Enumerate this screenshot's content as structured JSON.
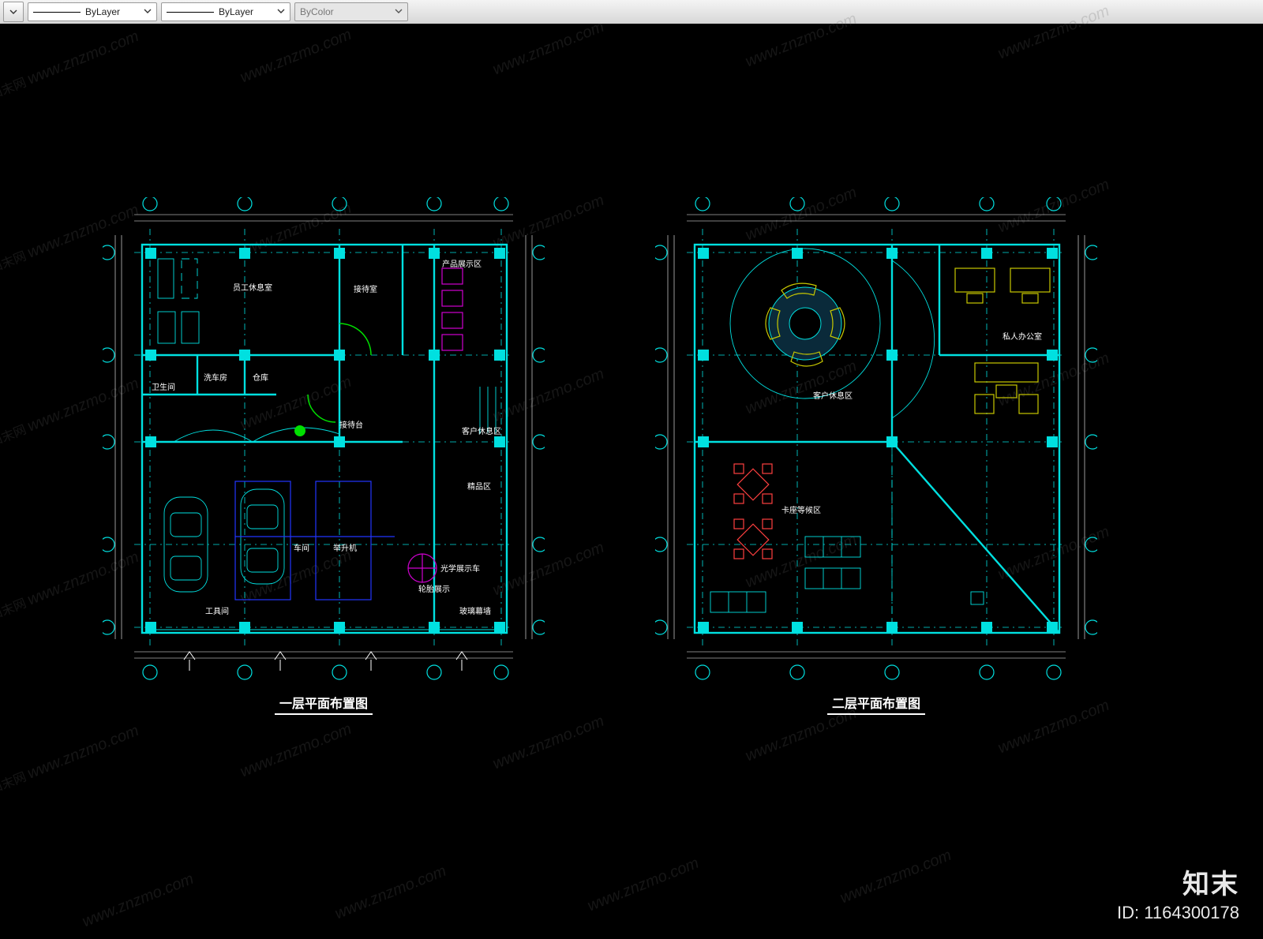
{
  "toolbar": {
    "linetype1": "ByLayer",
    "linetype2": "ByLayer",
    "colormode": "ByColor"
  },
  "watermark": {
    "cn": "知末网",
    "url": "www.znzmo.com"
  },
  "plans": {
    "floor1": {
      "title": "一层平面布置图",
      "rooms": {
        "staff_rest": "员工休息室",
        "meeting": "接待室",
        "product": "产品展示区",
        "washroom": "洗车房",
        "storage": "仓库",
        "wc": "卫生间",
        "reception": "接待台",
        "customer_rest": "客户休息区",
        "boutique": "精品区",
        "workshop": "车间",
        "tool": "工具间",
        "lift": "举升机",
        "display_car": "光学展示车",
        "wheel": "轮胎展示",
        "entry_hall": "玻璃幕墙"
      }
    },
    "floor2": {
      "title": "二层平面布置图",
      "rooms": {
        "vip_lounge": "客户休息区",
        "private": "私人办公室",
        "open_waiting": "卡座等候区"
      }
    }
  },
  "brand": {
    "name": "知末",
    "id_label": "ID: 1164300178"
  }
}
